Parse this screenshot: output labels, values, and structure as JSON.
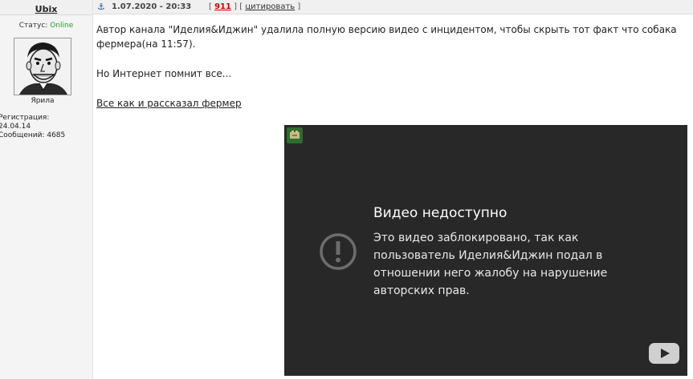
{
  "user": {
    "name": "Ubix",
    "status_label": "Статус:",
    "status_value": "Online",
    "rank": "Ярила",
    "registration_label": "Регистрация:",
    "registration_date": "24.04.14",
    "messages_label": "Сообщений:",
    "messages_count": "4685"
  },
  "post": {
    "date": "1.07.2020 - 20:33",
    "bracket_open": "[",
    "number": "911",
    "bracket_mid": "] [",
    "quote_label": "цитировать",
    "bracket_close": "]",
    "line1": "Автор канала \"Иделия&Иджин\" удалила полную версию видео с инцидентом, чтобы скрыть тот факт что собака фермера(на 11:57).",
    "line2": "Но Интернет помнит все...",
    "link_text": "Все как и рассказал фермер"
  },
  "video": {
    "title": "Видео недоступно",
    "message": "Это видео заблокировано, так как пользователь Иделия&Иджин подал в отношении него жалобу на нарушение авторских прав.",
    "icons": [
      "channel-badge-icon",
      "alert-icon",
      "youtube-logo-icon"
    ]
  },
  "colors": {
    "online": "#1fa32a",
    "post_number": "#cc0000",
    "video_bg": "#282828"
  }
}
